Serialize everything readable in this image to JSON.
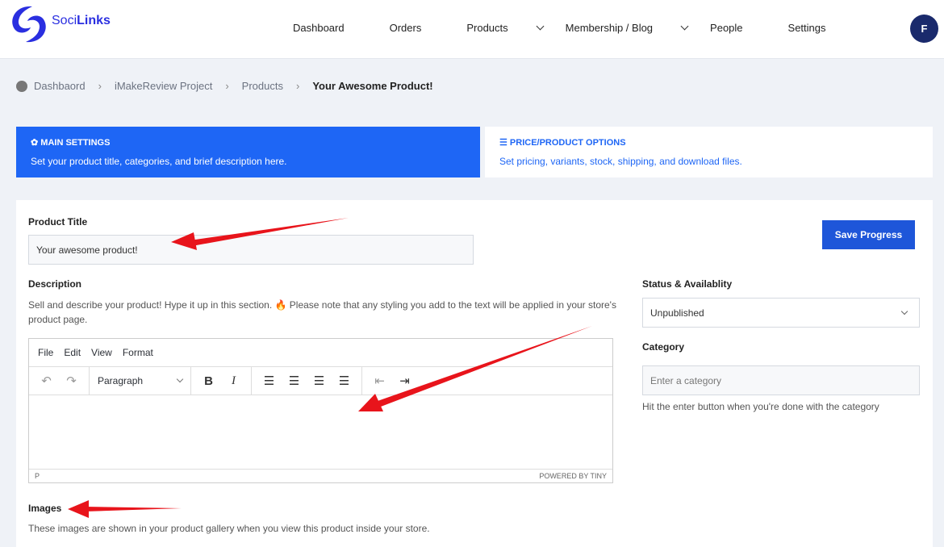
{
  "brand": {
    "name_a": "Soci",
    "name_b": "Links"
  },
  "nav": [
    {
      "label": "Dashboard"
    },
    {
      "label": "Orders"
    },
    {
      "label": "Products",
      "dropdown": true
    },
    {
      "label": "Membership / Blog",
      "dropdown": true
    },
    {
      "label": "People"
    },
    {
      "label": "Settings"
    }
  ],
  "user": {
    "initial": "F"
  },
  "breadcrumb": [
    "Dashbaord",
    "iMakeReview Project",
    "Products",
    "Your Awesome Product!"
  ],
  "tabs": [
    {
      "title": "MAIN SETTINGS",
      "icon": "gear-icon",
      "desc": "Set your product title, categories, and brief description here.",
      "active": true
    },
    {
      "title": "PRICE/PRODUCT OPTIONS",
      "icon": "sliders-icon",
      "desc": "Set pricing, variants, stock, shipping, and download files."
    }
  ],
  "form": {
    "title_label": "Product Title",
    "title_value": "Your awesome product!",
    "save_label": "Save Progress",
    "desc_label": "Description",
    "desc_help": "Sell and describe your product! Hype it up in this section. 🔥 Please note that any styling you add to the text will be applied in your store's product page.",
    "status_label": "Status & Availablity",
    "status_value": "Unpublished",
    "category_label": "Category",
    "category_placeholder": "Enter a category",
    "category_help": "Hit the enter button when you're done with the category",
    "images_label": "Images",
    "images_help": "These images are shown in your product gallery when you view this product inside your store."
  },
  "editor": {
    "menu": [
      "File",
      "Edit",
      "View",
      "Format"
    ],
    "block_format": "Paragraph",
    "status_path": "P",
    "branding": "POWERED BY TINY"
  },
  "colors": {
    "accent": "#1e66f5",
    "annotation": "#e8141b"
  }
}
